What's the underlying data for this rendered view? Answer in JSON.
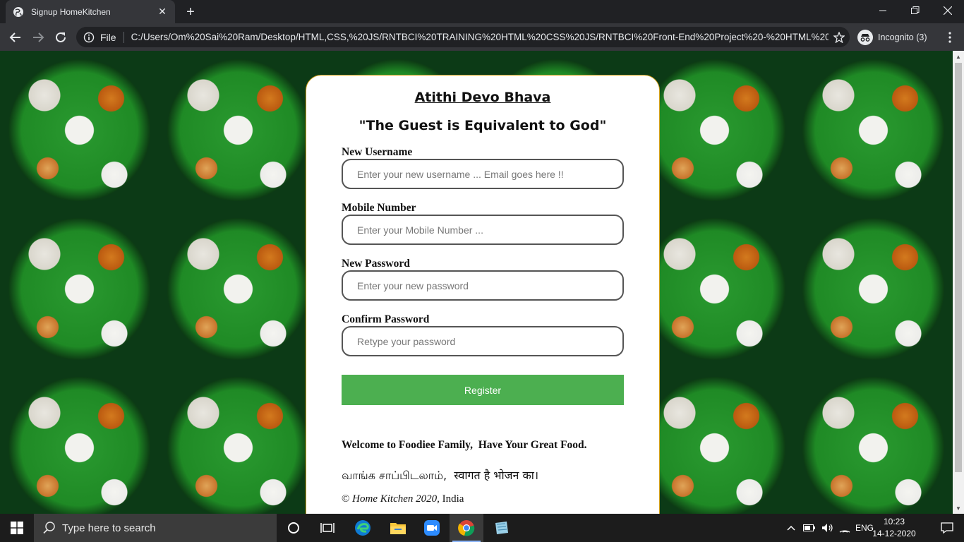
{
  "browser": {
    "tab_title": "Signup HomeKitchen",
    "new_tab_symbol": "+",
    "omnibox_scheme": "File",
    "url": "C:/Users/Om%20Sai%20Ram/Desktop/HTML,CSS,%20JS/RNTBCI%20TRAINING%20HTML%20CSS%20JS/RNTBCI%20Front-End%20Project%20-%20HTML%20...",
    "profile_label": "Incognito (3)"
  },
  "form": {
    "heading": "Atithi Devo Bhava",
    "subheading": "\"The Guest is Equivalent to God\"",
    "username_label": "New Username",
    "username_placeholder": "Enter your new username ... Email goes here !!",
    "mobile_label": "Mobile Number",
    "mobile_placeholder": "Enter your Mobile Number ...",
    "password_label": "New Password",
    "password_placeholder": "Enter your new password",
    "confirm_label": "Confirm Password",
    "confirm_placeholder": "Retype your password",
    "register_label": "Register",
    "welcome_text": "Welcome to Foodiee Family,  Have Your Great Food.",
    "multilang_text": "வாங்க சாப்பிடலாம்,  स्वागत है भोजन का।",
    "copyright_symbol": "©",
    "copyright_italic": "Home Kitchen 2020,",
    "copyright_country": "India"
  },
  "taskbar": {
    "search_placeholder": "Type here to search",
    "language": "ENG",
    "time": "10:23",
    "date": "14-12-2020"
  },
  "colors": {
    "register_button": "#4caf50",
    "card_border": "#d4a017",
    "chrome_bg": "#202124"
  }
}
